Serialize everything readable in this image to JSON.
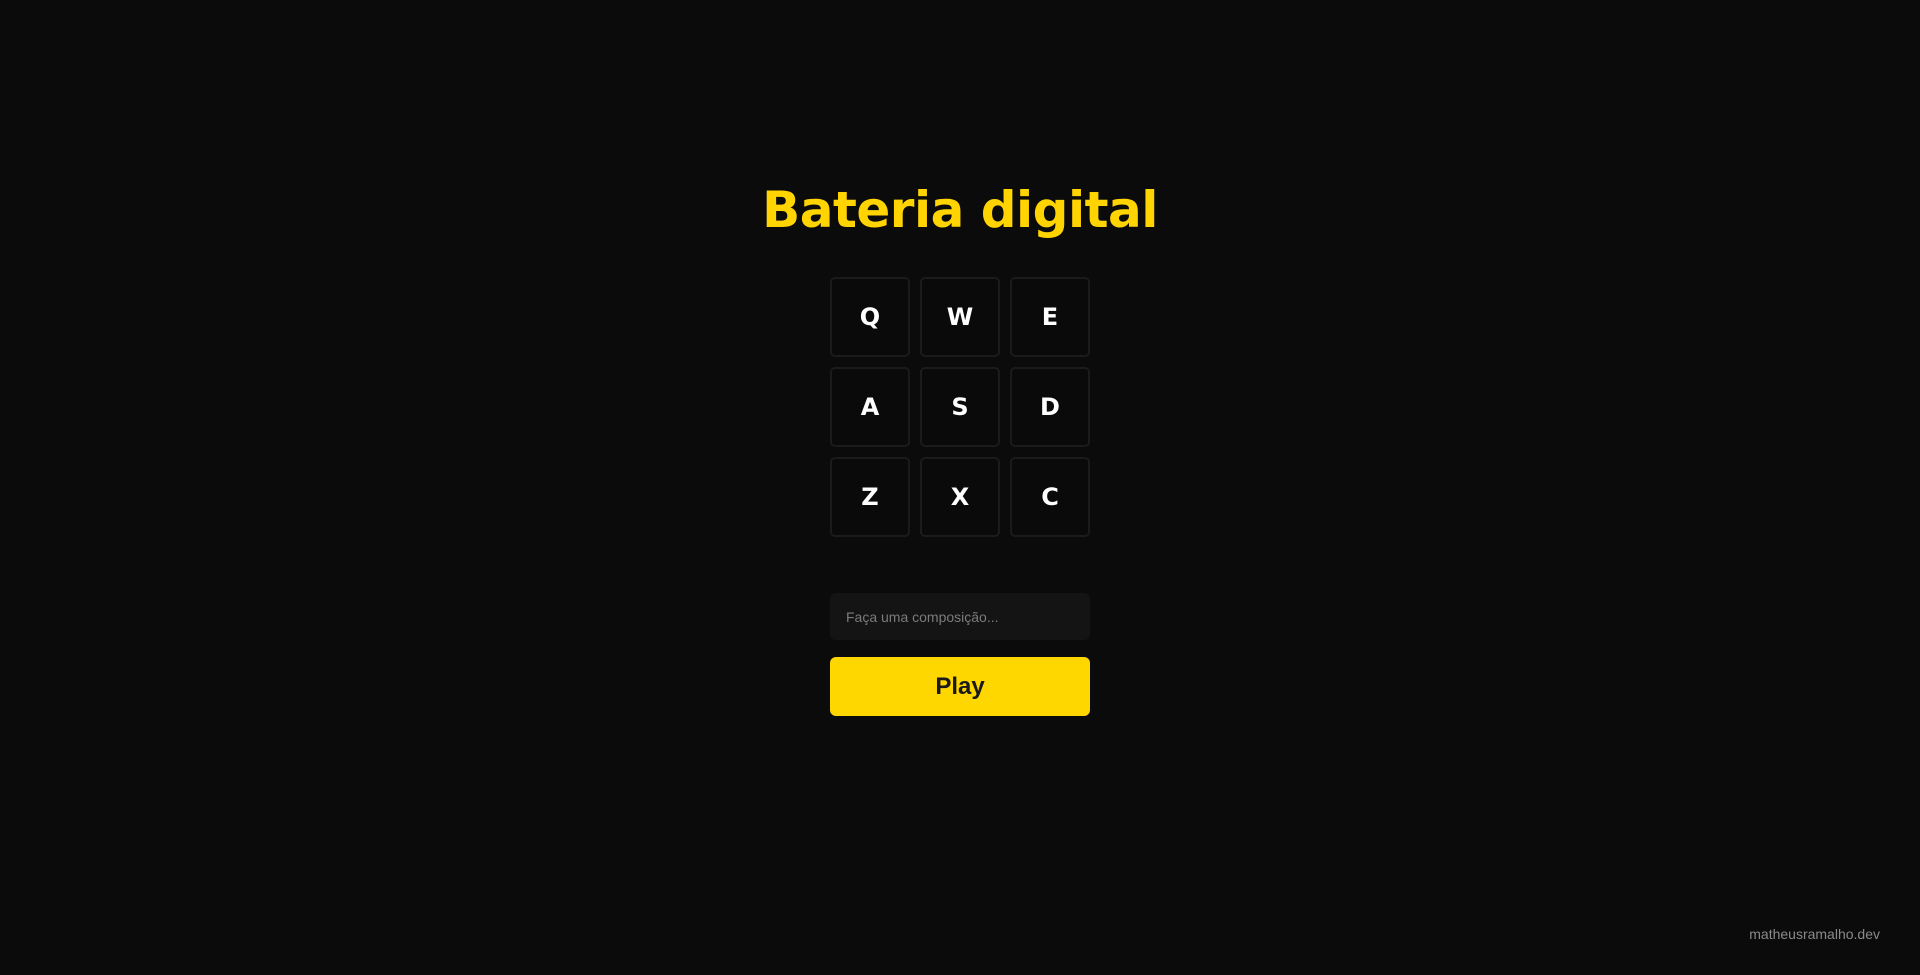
{
  "page": {
    "title": "Bateria digital"
  },
  "pads": [
    {
      "key": "Q"
    },
    {
      "key": "W"
    },
    {
      "key": "E"
    },
    {
      "key": "A"
    },
    {
      "key": "S"
    },
    {
      "key": "D"
    },
    {
      "key": "Z"
    },
    {
      "key": "X"
    },
    {
      "key": "C"
    }
  ],
  "composer": {
    "value": "",
    "placeholder": "Faça uma composição..."
  },
  "play_button": {
    "label": "Play"
  },
  "footer": {
    "credit": "matheusramalho.dev"
  },
  "colors": {
    "background": "#0b0b0b",
    "accent": "#ffd700",
    "pad_border": "#1b1b1b",
    "input_bg": "#141414"
  }
}
